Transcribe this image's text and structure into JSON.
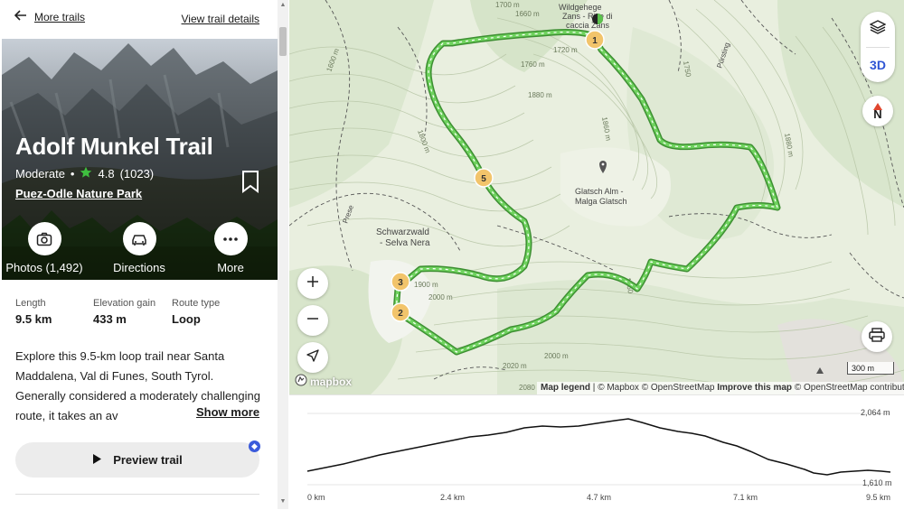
{
  "nav": {
    "back_label": "More trails",
    "details_label": "View trail details"
  },
  "trail": {
    "name": "Adolf Munkel Trail",
    "difficulty": "Moderate",
    "rating": "4.8",
    "rating_count": "(1023)",
    "park": "Puez-Odle Nature Park"
  },
  "actions": {
    "photos": "Photos (1,492)",
    "directions": "Directions",
    "more": "More"
  },
  "stats": {
    "length_label": "Length",
    "length_value": "9.5 km",
    "elevation_label": "Elevation gain",
    "elevation_value": "433 m",
    "route_label": "Route type",
    "route_value": "Loop"
  },
  "description": {
    "text": "Explore this 9.5-km loop trail near Santa Maddalena, Val di Funes, South Tyrol. Generally considered a moderately challenging route, it takes an av",
    "show_more": "Show more"
  },
  "preview": {
    "label": "Preview trail"
  },
  "map": {
    "toggle_3d": "3D",
    "compass_label": "N",
    "scale_label": "300 m",
    "logo_text": "mapbox",
    "attribution_legend": "Map legend",
    "attribution_mapbox": "© Mapbox",
    "attribution_osm": "© OpenStreetMap",
    "attribution_improve": "Improve this map",
    "attribution_osm2": "© OpenStreetMap contributors",
    "place_labels": {
      "wildgehege": "Wildgehege",
      "zans": "Zans - Rise di",
      "caccia": "caccia Zans",
      "glatsch1": "Glatsch Alm -",
      "glatsch2": "Malga Glatsch",
      "schwarzwald1": "Schwarzwald",
      "schwarzwald2": "- Selva Nera",
      "prese": "Prese",
      "pursting": "Pürsting"
    },
    "contours": [
      "1700 m",
      "1660 m",
      "1720 m",
      "1760 m",
      "1880 m",
      "1860 m",
      "1800 m",
      "1600 m",
      "1750",
      "1880 m",
      "1900 m",
      "2000 m",
      "2000 m",
      "2020 m",
      "2080",
      "1860"
    ],
    "waypoints": [
      "1",
      "2",
      "3",
      "5"
    ],
    "colors": {
      "trail": "#4cb840",
      "waypoint": "#f2c46b",
      "terrain": "#e8eedd"
    }
  },
  "elevation": {
    "max_label": "2,064 m",
    "min_label": "1,610 m",
    "x_ticks": [
      "0 km",
      "2.4 km",
      "4.7 km",
      "7.1 km",
      "9.5 km"
    ]
  }
}
